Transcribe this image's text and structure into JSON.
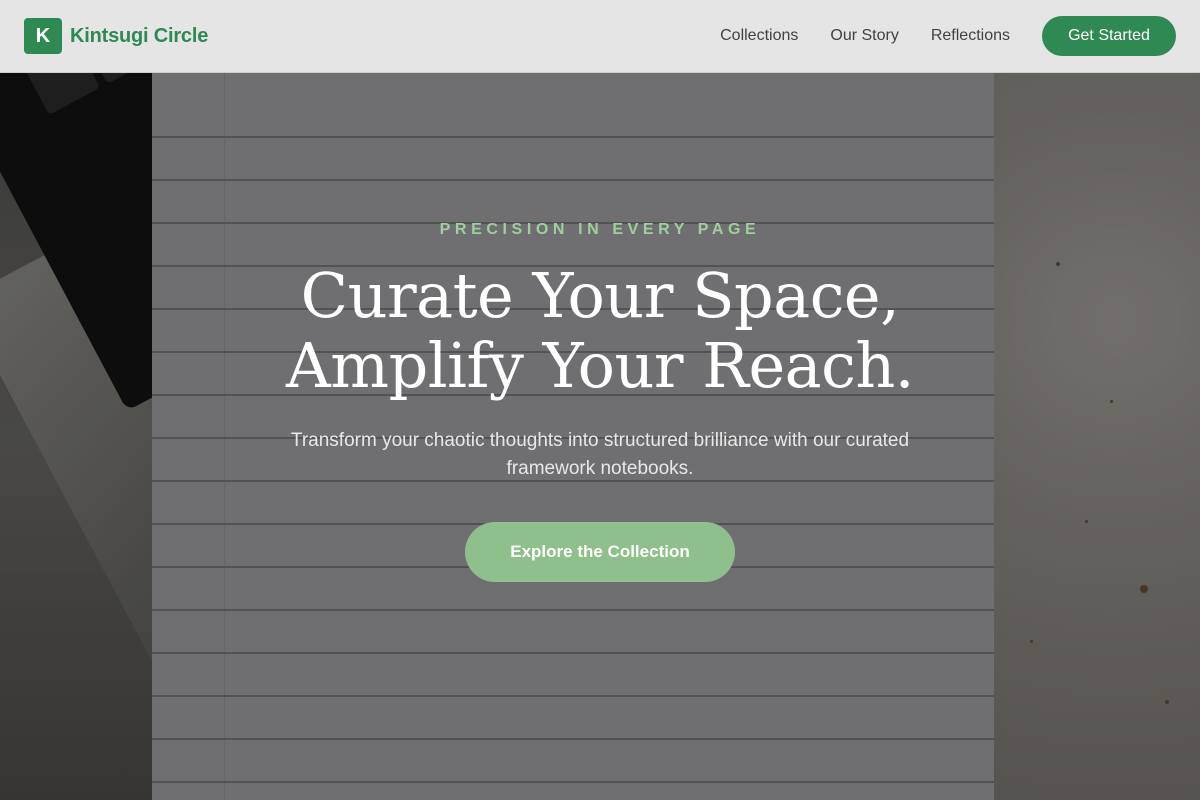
{
  "brand": {
    "mark": "K",
    "name": "Kintsugi Circle"
  },
  "nav": {
    "links": [
      "Collections",
      "Our Story",
      "Reflections"
    ],
    "cta_label": "Get Started"
  },
  "hero": {
    "eyebrow": "PRECISION IN EVERY PAGE",
    "headline_line1": "Curate Your Space,",
    "headline_line2": "Amplify Your Reach.",
    "subtitle": "Transform your chaotic thoughts into structured brilliance with our curated framework notebooks.",
    "button_label": "Explore the Collection"
  },
  "colors": {
    "brand_green": "#2e8a52",
    "eyebrow_green": "#9fcf9c",
    "hero_button": "#8fbf8a",
    "header_bg": "#e5e5e5"
  }
}
